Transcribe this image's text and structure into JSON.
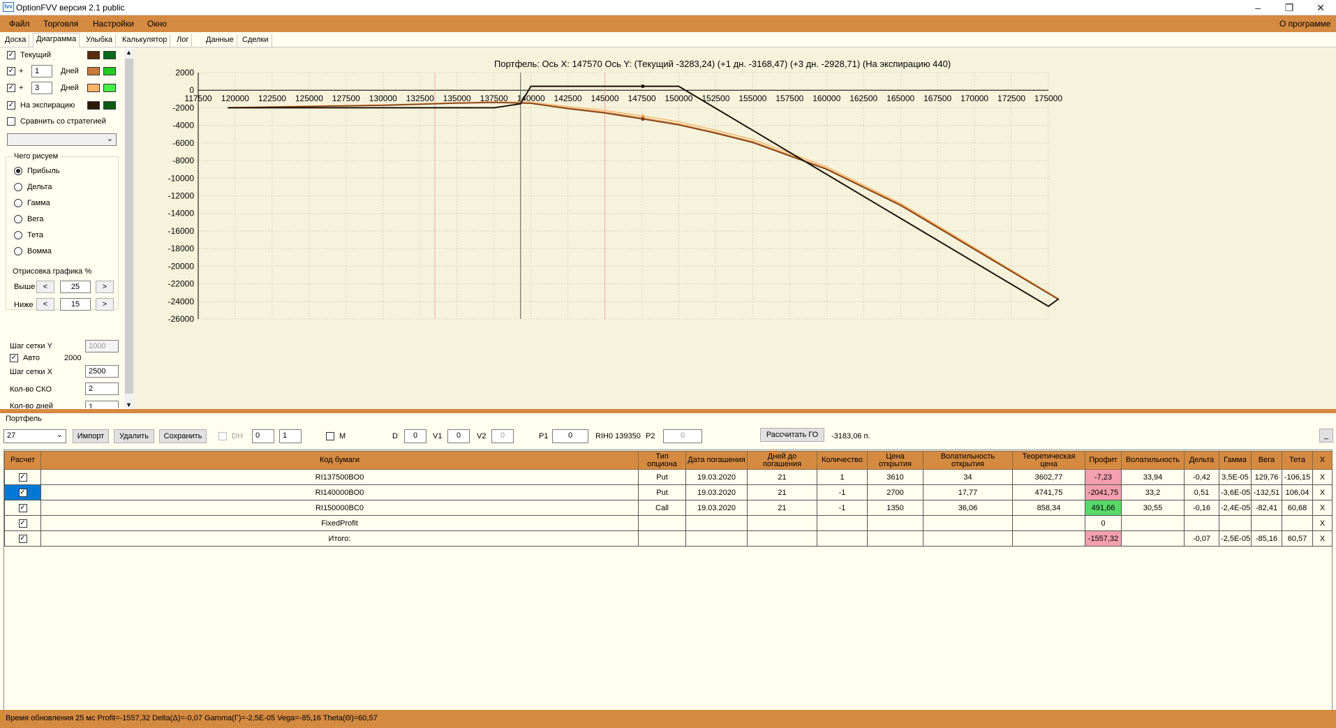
{
  "window": {
    "title": "OptionFVV версия 2.1 public",
    "icon_text": "fvv"
  },
  "menu": {
    "items": [
      "Файл",
      "Торговля",
      "Настройки",
      "Окно"
    ],
    "about": "О программе"
  },
  "tabs": [
    "Доска",
    "Диаграмма",
    "Улыбка",
    "Калькулятор",
    "Лог",
    "Данные",
    "Сделки"
  ],
  "left": {
    "current": "Текущий",
    "plus": "+",
    "days1": "1",
    "days3": "3",
    "days_label": "Дней",
    "expiry": "На экспирацию",
    "compare": "Сравнить со стратегией",
    "what_draw": "Чего рисуем",
    "radios": [
      "Прибыль",
      "Дельта",
      "Гамма",
      "Вега",
      "Тета",
      "Вомма"
    ],
    "drawing": "Отрисовка графика %",
    "above": "Выше",
    "above_val": "25",
    "below": "Ниже",
    "below_val": "15",
    "lt": "<",
    "gt": ">",
    "grid_y": "Шаг сетки Y",
    "grid_y_val": "1000",
    "auto": "Авто",
    "auto_val": "2000",
    "grid_x": "Шаг сетки X",
    "grid_x_val": "2500",
    "sko": "Кол-во СКО",
    "sko_val": "2",
    "points": "Кол-во дней",
    "points_val": "1"
  },
  "colors": {
    "accent": "#d58a41",
    "current_dark": "#5a2d0c",
    "current_green": "#0a6b1e",
    "plus1": "#c97a3a",
    "plus1_green": "#22cc22",
    "plus3": "#f8b46a",
    "plus3_green": "#44ee44",
    "expiry": "#2b1a0a",
    "expiry_green": "#0d5d14"
  },
  "chart_data": {
    "type": "line",
    "title": "Портфель: Ось X:  147570 Ось Y:   (Текущий -3283,24)  (+1 дн. -3168,47)  (+3 дн. -2928,71)  (На экспирацию 440)",
    "xlim": [
      117500,
      175000
    ],
    "ylim": [
      -26000,
      2000
    ],
    "xticks": [
      117500,
      120000,
      122500,
      125000,
      127500,
      130000,
      132500,
      135000,
      137500,
      140000,
      142500,
      145000,
      147500,
      150000,
      152500,
      155000,
      157500,
      160000,
      162500,
      165000,
      167500,
      170000,
      172500,
      175000
    ],
    "yticks": [
      2000,
      0,
      -2000,
      -4000,
      -6000,
      -8000,
      -10000,
      -12000,
      -14000,
      -16000,
      -18000,
      -20000,
      -22000,
      -24000,
      -26000
    ],
    "grid": true,
    "cursor_x": 139300,
    "marker_x": 147570,
    "vlines": [
      133500,
      145000
    ],
    "series": [
      {
        "name": "На экспирацию",
        "x": [
          119500,
          137500,
          139300,
          140000,
          147570,
          150000,
          155000,
          160000,
          165000,
          170000,
          175000,
          175700
        ],
        "y": [
          -2000,
          -2000,
          -1550,
          440,
          440,
          440,
          -4560,
          -9560,
          -14560,
          -19560,
          -24560,
          -23700
        ]
      },
      {
        "name": "Текущий",
        "x": [
          119500,
          130000,
          135000,
          137500,
          140000,
          142500,
          145000,
          147570,
          150000,
          152500,
          155000,
          160000,
          165000,
          170000,
          175700
        ],
        "y": [
          -2000,
          -1720,
          -1480,
          -1400,
          -1500,
          -2100,
          -2600,
          -3283,
          -3950,
          -4900,
          -5950,
          -9000,
          -13100,
          -18100,
          -23800
        ]
      },
      {
        "name": "+1 дн.",
        "x": [
          119500,
          130000,
          135000,
          137500,
          140000,
          142500,
          145000,
          147570,
          150000,
          152500,
          155000,
          160000,
          165000,
          170000,
          175700
        ],
        "y": [
          -1980,
          -1700,
          -1450,
          -1370,
          -1460,
          -2020,
          -2500,
          -3168,
          -3840,
          -4800,
          -5850,
          -8900,
          -13000,
          -18000,
          -23750
        ]
      },
      {
        "name": "+3 дн.",
        "x": [
          119500,
          130000,
          135000,
          137500,
          140000,
          142500,
          145000,
          147570,
          150000,
          152500,
          155000,
          160000,
          165000,
          170000,
          175700
        ],
        "y": [
          -1950,
          -1650,
          -1400,
          -1320,
          -1380,
          -1850,
          -2300,
          -2929,
          -3600,
          -4550,
          -5600,
          -8700,
          -12850,
          -17900,
          -23700
        ]
      }
    ]
  },
  "portfolio": {
    "label": "Портфель",
    "number": "27",
    "import": "Импорт",
    "delete": "Удалить",
    "save": "Сохранить",
    "dh": "DH",
    "spin1": "0",
    "spin2": "1",
    "m": "M",
    "d": "D",
    "d_val": "0",
    "v1": "V1",
    "v1_val": "0",
    "v2": "V2",
    "v2_val": "0",
    "p1": "P1",
    "p1_val": "0",
    "rih": "RIH0 139350",
    "p2": "P2",
    "p2_val": "0",
    "calc": "Рассчитать ГО",
    "go_val": "-3183,06 п.",
    "min": "_"
  },
  "table": {
    "headers": [
      "Расчет",
      "Код бумаги",
      "Тип опциона",
      "Дата погашения",
      "Дней до погашения",
      "Количество",
      "Цена открытия",
      "Волатильность открытия",
      "Теоретическая цена",
      "Профит",
      "Волатильность",
      "Дельта",
      "Гамма",
      "Вега",
      "Тета",
      "X"
    ],
    "rows": [
      [
        "",
        "RI137500BO0",
        "Put",
        "19.03.2020",
        "21",
        "1",
        "3610",
        "34",
        "3602,77",
        "-7,23",
        "33,94",
        "-0,42",
        "3,5E-05",
        "129,76",
        "-106,15",
        "X"
      ],
      [
        "",
        "RI140000BO0",
        "Put",
        "19.03.2020",
        "21",
        "-1",
        "2700",
        "17,77",
        "4741,75",
        "-2041,75",
        "33,2",
        "0,51",
        "-3,6E-05",
        "-132,51",
        "106,04",
        "X"
      ],
      [
        "",
        "RI150000BC0",
        "Call",
        "19.03.2020",
        "21",
        "-1",
        "1350",
        "36,06",
        "858,34",
        "491,66",
        "30,55",
        "-0,16",
        "-2,4E-05",
        "-82,41",
        "60,68",
        "X"
      ],
      [
        "",
        "FixedProfit",
        "",
        "",
        "",
        "",
        "",
        "",
        "",
        "0",
        "",
        "",
        "",
        "",
        "",
        "X"
      ],
      [
        "",
        "Итого:",
        "",
        "",
        "",
        "",
        "",
        "",
        "",
        "-1557,32",
        "",
        "-0,07",
        "-2,5E-05",
        "-85,16",
        "60,57",
        "X"
      ]
    ]
  },
  "status": "Время обновления 25 мс  Profit=-1557,32 Delta(Δ)=-0,07 Gamma(Γ)=-2,5E-05 Vega=-85,16 Theta(Θ)=60,57"
}
